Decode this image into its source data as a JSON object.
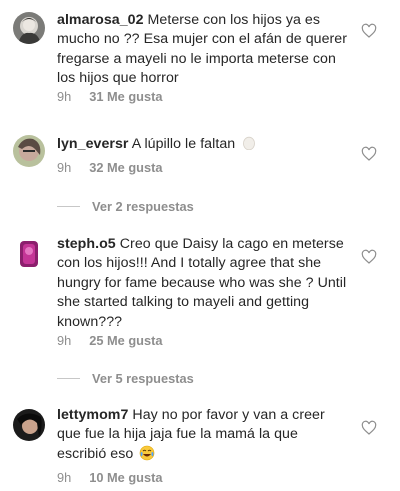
{
  "comments": [
    {
      "username": "almarosa_02",
      "text": "Meterse con los hijos ya es mucho no ?? Esa mujer con el afán de querer fregarse a mayeli no le importa meterse con los hijos que horror",
      "time": "9h",
      "likes": "31 Me gusta",
      "avatar_icon": "profile-photo"
    },
    {
      "username": "lyn_eversr",
      "text": "A lúpillo le faltan",
      "emoji": "egg",
      "time": "9h",
      "likes": "32 Me gusta",
      "replies": "Ver 2 respuestas",
      "avatar_icon": "profile-photo"
    },
    {
      "username": "steph.o5",
      "text": "Creo que Daisy la cago en meterse con los hijos!!! And I totally agree that she hungry for fame because who was she ? Until she started talking to mayeli and getting known???",
      "time": "9h",
      "likes": "25 Me gusta",
      "replies": "Ver 5 respuestas",
      "avatar_icon": "profile-photo"
    },
    {
      "username": "lettymom7",
      "text": "Hay no por favor y van a creer que fue la hija jaja fue la mamá la que escribió eso",
      "emoji": "tears-of-joy",
      "time": "9h",
      "likes": "10 Me gusta",
      "avatar_icon": "profile-photo"
    }
  ],
  "colors": {
    "text": "#262626",
    "secondary": "#8e8e8e",
    "divider": "#c7c7c7"
  }
}
